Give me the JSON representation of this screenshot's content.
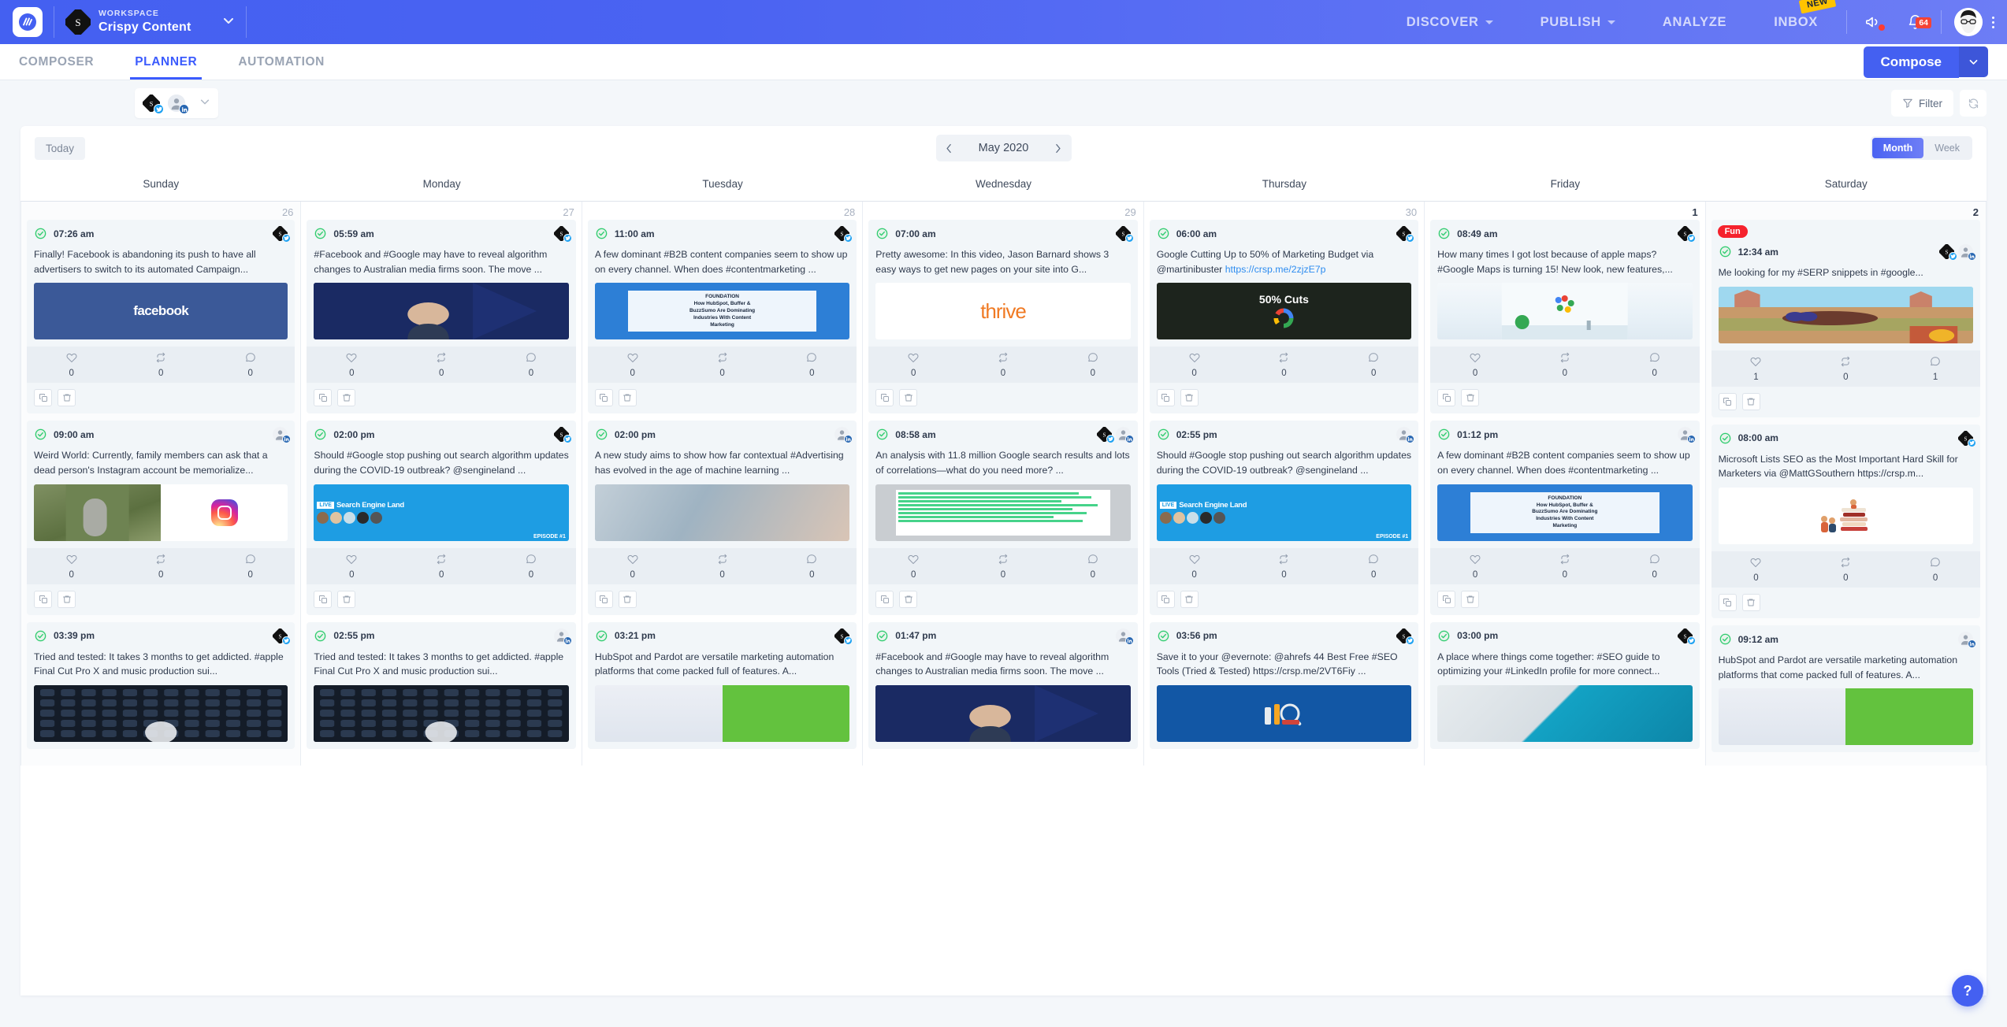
{
  "topbar": {
    "workspace_label": "WORKSPACE",
    "workspace_name": "Crispy Content",
    "nav": [
      {
        "label": "DISCOVER",
        "caret": true
      },
      {
        "label": "PUBLISH",
        "caret": true
      },
      {
        "label": "ANALYZE",
        "caret": false
      },
      {
        "label": "INBOX",
        "caret": false,
        "flag": "NEW"
      }
    ],
    "notification_count": "64",
    "accent": "#4460f1"
  },
  "subnav": {
    "tabs": [
      {
        "label": "COMPOSER",
        "active": false
      },
      {
        "label": "PLANNER",
        "active": true
      },
      {
        "label": "AUTOMATION",
        "active": false
      }
    ],
    "compose_label": "Compose"
  },
  "toolbar": {
    "filter_label": "Filter",
    "refresh_name": "refresh-icon"
  },
  "calendar": {
    "today_label": "Today",
    "month_label": "May 2020",
    "views": [
      {
        "label": "Month",
        "active": true
      },
      {
        "label": "Week",
        "active": false
      }
    ],
    "daynames": [
      "Sunday",
      "Monday",
      "Tuesday",
      "Wednesday",
      "Thursday",
      "Friday",
      "Saturday"
    ],
    "daynumbers": [
      "26",
      "27",
      "28",
      "29",
      "30",
      "1",
      "2"
    ],
    "columns": [
      {
        "day": "Sunday",
        "posts": [
          {
            "time": "07:26 am",
            "text": "Finally! Facebook is abandoning its push to have all advertisers to switch to its automated Campaign...",
            "networks": [
              "twitter"
            ],
            "media": "facebook-logo",
            "likes": "0",
            "retweets": "0",
            "comments": "0"
          },
          {
            "time": "09:00 am",
            "text": "Weird World: Currently, family members can ask that a dead person's Instagram account be memorialize...",
            "networks": [
              "linkedin"
            ],
            "media": "gravestone-instagram",
            "likes": "0",
            "retweets": "0",
            "comments": "0"
          },
          {
            "time": "03:39 pm",
            "text": "Tried and tested: It takes 3 months to get addicted. #apple Final Cut Pro X and music production sui...",
            "networks": [
              "twitter"
            ],
            "media": "dark-keyboard",
            "likes": "0",
            "retweets": "0",
            "comments": "0"
          }
        ]
      },
      {
        "day": "Monday",
        "posts": [
          {
            "time": "05:59 am",
            "text": "#Facebook and #Google may have to reveal algorithm changes to Australian media firms soon. The move ...",
            "networks": [
              "twitter"
            ],
            "media": "zuckerberg-stage",
            "likes": "0",
            "retweets": "0",
            "comments": "0"
          },
          {
            "time": "02:00 pm",
            "text": "Should #Google stop pushing out search algorithm updates during the COVID-19 outbreak? @sengineland ...",
            "networks": [
              "twitter"
            ],
            "media": "search-engine-land",
            "likes": "0",
            "retweets": "0",
            "comments": "0"
          },
          {
            "time": "02:55 pm",
            "text": "Tried and tested: It takes 3 months to get addicted. #apple Final Cut Pro X and music production sui...",
            "networks": [
              "linkedin"
            ],
            "media": "dark-keyboard",
            "likes": "0",
            "retweets": "0",
            "comments": "0"
          }
        ]
      },
      {
        "day": "Tuesday",
        "posts": [
          {
            "time": "11:00 am",
            "text": "A few dominant #B2B content companies seem to show up on every channel. When does #contentmarketing ...",
            "networks": [
              "twitter"
            ],
            "media": "foundation-banner",
            "likes": "0",
            "retweets": "0",
            "comments": "0"
          },
          {
            "time": "02:00 pm",
            "text": "A new study aims to show how far contextual #Advertising has evolved in the age of machine learning ...",
            "networks": [
              "linkedin"
            ],
            "media": "phone-hands",
            "likes": "0",
            "retweets": "0",
            "comments": "0"
          },
          {
            "time": "03:21 pm",
            "text": "HubSpot and Pardot are versatile marketing automation platforms that come packed full of features. A...",
            "networks": [
              "twitter"
            ],
            "media": "hubspot-green",
            "likes": "0",
            "retweets": "0",
            "comments": "0"
          }
        ]
      },
      {
        "day": "Wednesday",
        "posts": [
          {
            "time": "07:00 am",
            "text": "Pretty awesome: In this video, Jason Barnard shows 3 easy ways to get new pages on your site into G...",
            "networks": [
              "twitter"
            ],
            "media": "thrive-logo",
            "likes": "0",
            "retweets": "0",
            "comments": "0"
          },
          {
            "time": "08:58 am",
            "text": "An analysis with 11.8 million Google search results and lots of correlations—what do you need more? ...",
            "networks": [
              "twitter",
              "linkedin"
            ],
            "media": "domain-rating-chart",
            "likes": "0",
            "retweets": "0",
            "comments": "0"
          },
          {
            "time": "01:47 pm",
            "text": "#Facebook and #Google may have to reveal algorithm changes to Australian media firms soon. The move ...",
            "networks": [
              "linkedin"
            ],
            "media": "zuckerberg-stage",
            "likes": "0",
            "retweets": "0",
            "comments": "0"
          }
        ]
      },
      {
        "day": "Thursday",
        "posts": [
          {
            "time": "06:00 am",
            "text": "Google Cutting Up to 50% of Marketing Budget via @martinibuster ",
            "link": "https://crsp.me/2zjzE7p",
            "networks": [
              "twitter"
            ],
            "media": "google-50-cuts",
            "likes": "0",
            "retweets": "0",
            "comments": "0"
          },
          {
            "time": "02:55 pm",
            "text": "Should #Google stop pushing out search algorithm updates during the COVID-19 outbreak? @sengineland ...",
            "networks": [
              "linkedin"
            ],
            "media": "search-engine-land",
            "likes": "0",
            "retweets": "0",
            "comments": "0"
          },
          {
            "time": "03:56 pm",
            "text": "Save it to your @evernote: @ahrefs 44 Best Free #SEO Tools (Tried & Tested) https://crsp.me/2VT6Fiy ...",
            "networks": [
              "twitter"
            ],
            "media": "seo-tools",
            "likes": "0",
            "retweets": "0",
            "comments": "0"
          }
        ]
      },
      {
        "day": "Friday",
        "posts": [
          {
            "time": "08:49 am",
            "text": "How many times I got lost because of apple maps? #Google Maps is turning 15! New look, new features,...",
            "networks": [
              "twitter"
            ],
            "media": "google-maps",
            "likes": "0",
            "retweets": "0",
            "comments": "0"
          },
          {
            "time": "01:12 pm",
            "text": "A few dominant #B2B content companies seem to show up on every channel. When does #contentmarketing ...",
            "networks": [
              "linkedin"
            ],
            "media": "foundation-banner",
            "likes": "0",
            "retweets": "0",
            "comments": "0"
          },
          {
            "time": "03:00 pm",
            "text": "A place where things come together: #SEO guide to optimizing your #LinkedIn profile for more connect...",
            "networks": [
              "twitter"
            ],
            "media": "phone-teal",
            "likes": "0",
            "retweets": "0",
            "comments": "0"
          }
        ]
      },
      {
        "day": "Saturday",
        "posts": [
          {
            "time": "12:34 am",
            "tag": "Fun",
            "text": "Me looking for my #SERP snippets in #google...",
            "networks": [
              "twitter",
              "linkedin"
            ],
            "media": "wile-e-coyote",
            "likes": "1",
            "retweets": "0",
            "comments": "1"
          },
          {
            "time": "08:00 am",
            "text": "Microsoft Lists SEO as the Most Important Hard Skill for Marketers via @MattGSouthern https://crsp.m...",
            "networks": [
              "twitter"
            ],
            "media": "books-illustration",
            "likes": "0",
            "retweets": "0",
            "comments": "0"
          },
          {
            "time": "09:12 am",
            "text": "HubSpot and Pardot are versatile marketing automation platforms that come packed full of features. A...",
            "networks": [
              "linkedin"
            ],
            "media": "hubspot-green",
            "likes": "0",
            "retweets": "0",
            "comments": "0"
          }
        ]
      }
    ]
  },
  "help_button": {
    "label": "?"
  }
}
